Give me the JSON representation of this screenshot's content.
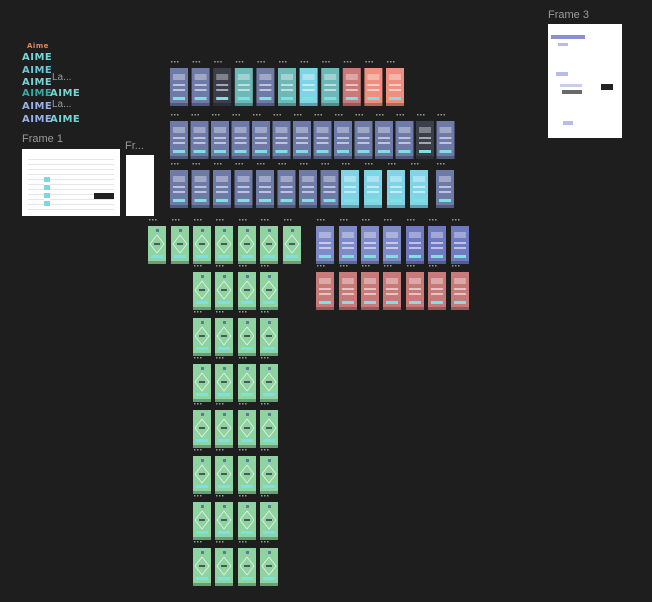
{
  "canvas": {
    "background": "#1e1e1e"
  },
  "frames": {
    "frame1": {
      "label": "Frame 1"
    },
    "frame_small": {
      "label": "Fr..."
    },
    "frame3": {
      "label": "Frame 3"
    }
  },
  "logo": {
    "small_mark": "Aime",
    "word": "AIME",
    "truncated_label": "La...",
    "colors": [
      "#7ad3d3",
      "#3aa9a0",
      "#9ab0e8",
      "#e0885a"
    ]
  },
  "screen_palette": {
    "blue": "#7f8ac8",
    "slate": "#6e7aa8",
    "teal": "#6fb8b8",
    "sky": "#7fd4e8",
    "green": "#8fd3a0",
    "rose": "#c87a78",
    "salmon": "#ef8f7f",
    "accent": "#7fe0e0",
    "dark": "#3a3f4a"
  },
  "frame_overflow_icon": "more-dots-icon"
}
